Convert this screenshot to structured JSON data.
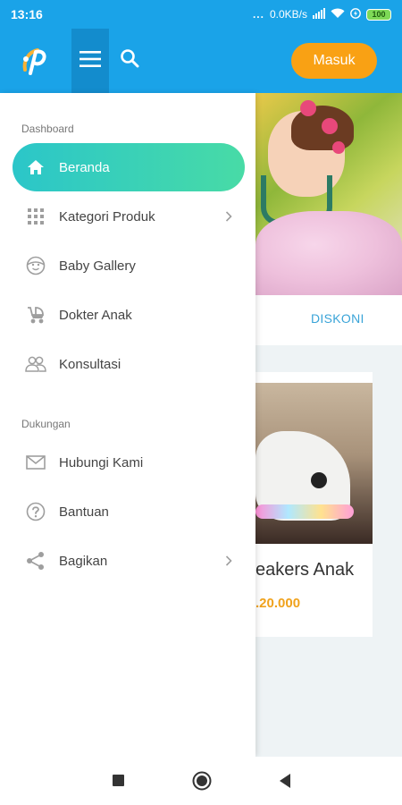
{
  "status_bar": {
    "time": "13:16",
    "signal_dots": "...",
    "network_speed": "0.0KB/s",
    "battery": "100"
  },
  "app_bar": {
    "login_label": "Masuk",
    "icons": [
      "logo",
      "menu-icon",
      "search-icon"
    ]
  },
  "drawer": {
    "section_dashboard": "Dashboard",
    "section_support": "Dukungan",
    "items": [
      {
        "label": "Beranda",
        "icon": "home-icon",
        "active": true
      },
      {
        "label": "Kategori Produk",
        "icon": "grid-icon",
        "chevron": true
      },
      {
        "label": "Baby Gallery",
        "icon": "baby-face-icon"
      },
      {
        "label": "Dokter Anak",
        "icon": "stroller-icon"
      },
      {
        "label": "Konsultasi",
        "icon": "people-icon"
      },
      {
        "label": "Hubungi Kami",
        "icon": "mail-icon"
      },
      {
        "label": "Bantuan",
        "icon": "help-icon"
      },
      {
        "label": "Bagikan",
        "icon": "share-icon",
        "chevron": true
      }
    ]
  },
  "background": {
    "tab_label": "DISKONI",
    "product_name": "eakers Anak",
    "product_price": ".20.000"
  },
  "colors": {
    "primary": "#1aa3e8",
    "accent": "#f9a114",
    "active_start": "#2bc6c9",
    "active_end": "#48dba6"
  }
}
